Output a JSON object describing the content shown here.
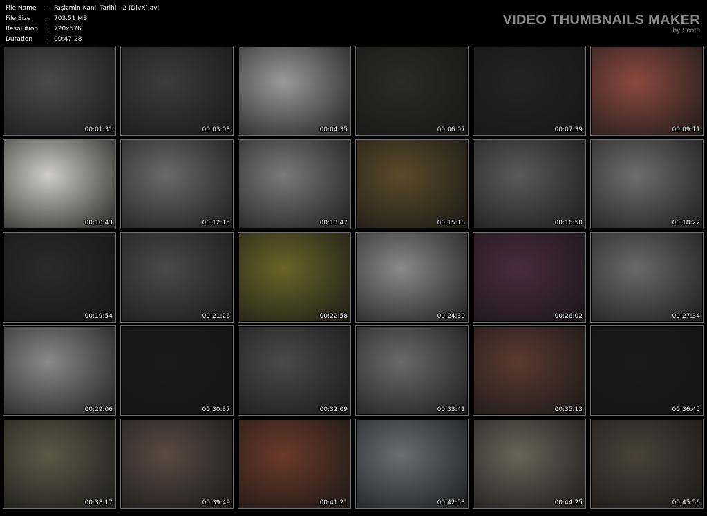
{
  "file_info": [
    {
      "key": "File Name",
      "value": "Faşizmin Kanlı Tarihi - 2 (DivX).avi"
    },
    {
      "key": "File Size",
      "value": "703.51 MB"
    },
    {
      "key": "Resolution",
      "value": "720x576"
    },
    {
      "key": "Duration",
      "value": "00:47:28"
    }
  ],
  "brand": {
    "title": "VIDEO THUMBNAILS MAKER",
    "byline": "by Scorp"
  },
  "thumbnails": [
    {
      "time": "00:01:31",
      "bg": "#4a4a4a"
    },
    {
      "time": "00:03:03",
      "bg": "#3c3c3c"
    },
    {
      "time": "00:04:35",
      "bg": "#9a9a9a"
    },
    {
      "time": "00:06:07",
      "bg": "#2a2a28"
    },
    {
      "time": "00:07:39",
      "bg": "#232323"
    },
    {
      "time": "00:09:11",
      "bg": "#8a4a40"
    },
    {
      "time": "00:10:43",
      "bg": "#cfcfc8"
    },
    {
      "time": "00:12:15",
      "bg": "#6a6a6a"
    },
    {
      "time": "00:13:47",
      "bg": "#7a7a7a"
    },
    {
      "time": "00:15:18",
      "bg": "#5a4a2a"
    },
    {
      "time": "00:16:50",
      "bg": "#5a5a5a"
    },
    {
      "time": "00:18:22",
      "bg": "#6e6e6e"
    },
    {
      "time": "00:19:54",
      "bg": "#2a2a2a"
    },
    {
      "time": "00:21:26",
      "bg": "#4a4a4a"
    },
    {
      "time": "00:22:58",
      "bg": "#6a6428"
    },
    {
      "time": "00:24:30",
      "bg": "#8a8a8a"
    },
    {
      "time": "00:26:02",
      "bg": "#4a2a40"
    },
    {
      "time": "00:27:34",
      "bg": "#6a6a6a"
    },
    {
      "time": "00:29:06",
      "bg": "#8a8a8a"
    },
    {
      "time": "00:30:37",
      "bg": "#1a1a1a"
    },
    {
      "time": "00:32:09",
      "bg": "#4a4a4a"
    },
    {
      "time": "00:33:41",
      "bg": "#6a6a6a"
    },
    {
      "time": "00:35:13",
      "bg": "#5a3a30"
    },
    {
      "time": "00:36:45",
      "bg": "#1a1a1a"
    },
    {
      "time": "00:38:17",
      "bg": "#5a5a48"
    },
    {
      "time": "00:39:49",
      "bg": "#5a4a42"
    },
    {
      "time": "00:41:21",
      "bg": "#6a3a2a"
    },
    {
      "time": "00:42:53",
      "bg": "#6a6e72"
    },
    {
      "time": "00:44:25",
      "bg": "#6a6458"
    },
    {
      "time": "00:45:56",
      "bg": "#4a4238"
    }
  ]
}
